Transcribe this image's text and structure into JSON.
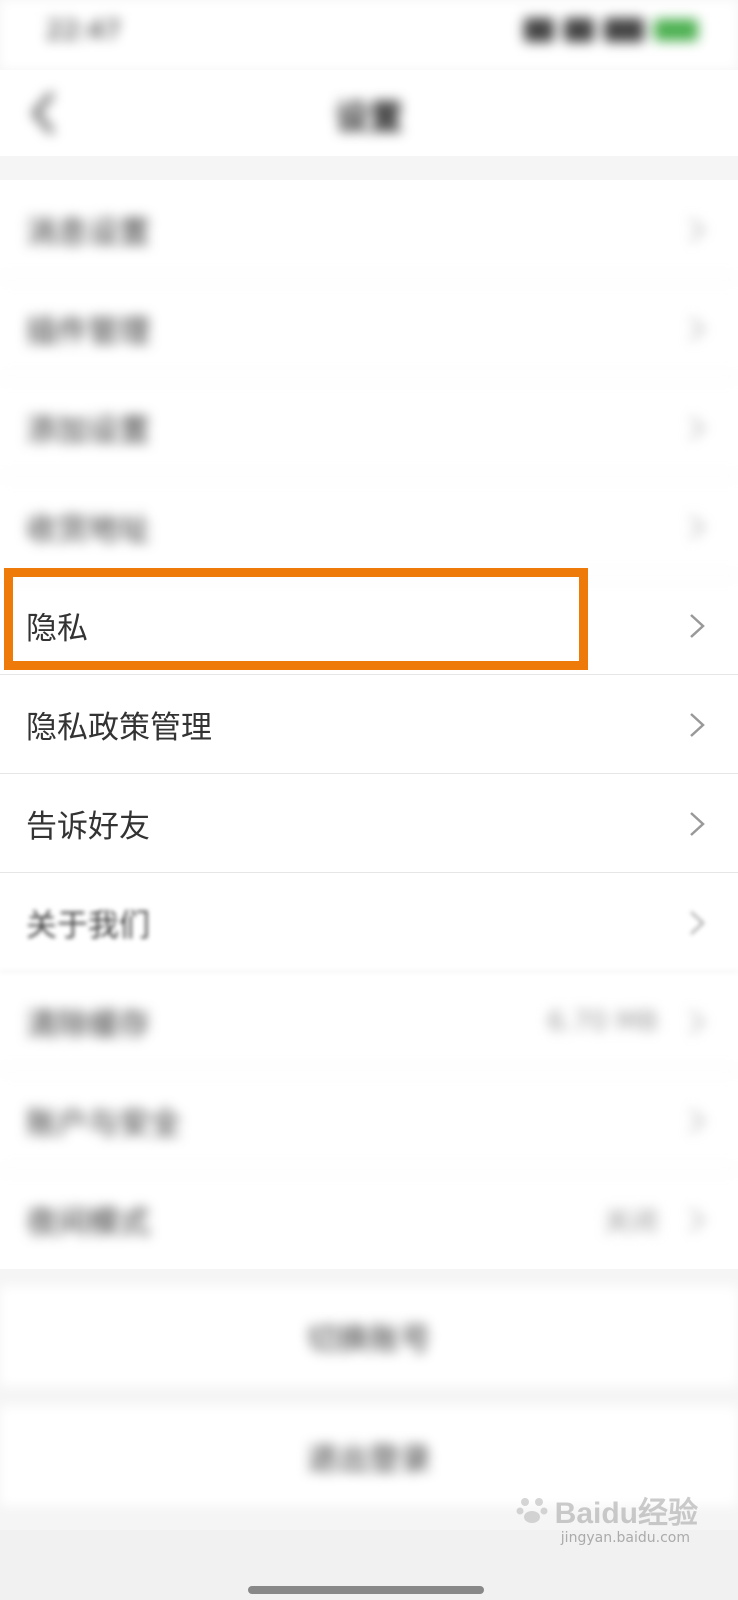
{
  "status_bar": {
    "time": "22:47",
    "battery": "94"
  },
  "nav": {
    "title": "设置"
  },
  "rows": [
    {
      "label": "消息设置",
      "value": ""
    },
    {
      "label": "插件管理",
      "value": ""
    },
    {
      "label": "添加设置",
      "value": ""
    },
    {
      "label": "收货地址",
      "value": ""
    },
    {
      "label": "隐私",
      "value": ""
    },
    {
      "label": "隐私政策管理",
      "value": ""
    },
    {
      "label": "告诉好友",
      "value": ""
    },
    {
      "label": "关于我们",
      "value": ""
    },
    {
      "label": "清除缓存",
      "value": "6.70 MB"
    },
    {
      "label": "账户与安全",
      "value": ""
    },
    {
      "label": "夜间模式",
      "value": "关闭"
    }
  ],
  "actions": {
    "switch_account": "切换账号",
    "logout": "退出登录"
  },
  "watermark": {
    "brand": "Baidu经验",
    "url": "jingyan.baidu.com"
  },
  "colors": {
    "highlight": "#ee7a0a"
  },
  "icons": {
    "back": "back-chevron-icon",
    "row_arrow": "chevron-right-icon"
  }
}
